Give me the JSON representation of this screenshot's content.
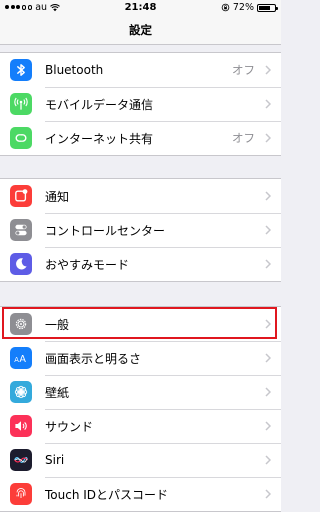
{
  "status_bar": {
    "carrier": "au",
    "time": "21:48",
    "battery_percent_label": "72%",
    "battery_level": 0.72,
    "signal_bars_filled": 3,
    "icons": [
      "signal-dots-icon",
      "wifi-icon",
      "orientation-lock-icon",
      "battery-icon"
    ]
  },
  "nav": {
    "title": "設定"
  },
  "colors": {
    "bluetooth": "#147efb",
    "cellular": "#4cd964",
    "hotspot": "#4cd964",
    "notifications": "#fc3d39",
    "control_center": "#8e8e93",
    "dnd": "#5e5ce6",
    "general": "#8e8e93",
    "display": "#147efb",
    "wallpaper": "#34aadc",
    "sounds": "#fc3158",
    "siri": "#1c1c2e",
    "touchid": "#fc3d39",
    "highlight_box": "#e0171f"
  },
  "groups": [
    {
      "items": [
        {
          "label": "Bluetooth",
          "value": "オフ",
          "icon": "bluetooth-icon"
        },
        {
          "label": "モバイルデータ通信",
          "value": "",
          "icon": "cellular-antenna-icon"
        },
        {
          "label": "インターネット共有",
          "value": "オフ",
          "icon": "personal-hotspot-icon"
        }
      ]
    },
    {
      "items": [
        {
          "label": "通知",
          "value": "",
          "icon": "notifications-icon"
        },
        {
          "label": "コントロールセンター",
          "value": "",
          "icon": "control-center-toggles-icon"
        },
        {
          "label": "おやすみモード",
          "value": "",
          "icon": "moon-icon"
        }
      ]
    },
    {
      "items": [
        {
          "label": "一般",
          "value": "",
          "icon": "gear-icon"
        },
        {
          "label": "画面表示と明るさ",
          "value": "",
          "icon": "display-aa-icon"
        },
        {
          "label": "壁紙",
          "value": "",
          "icon": "wallpaper-flower-icon"
        },
        {
          "label": "サウンド",
          "value": "",
          "icon": "speaker-icon"
        },
        {
          "label": "Siri",
          "value": "",
          "icon": "siri-icon"
        },
        {
          "label": "Touch IDとパスコード",
          "value": "",
          "icon": "fingerprint-icon"
        }
      ]
    }
  ]
}
